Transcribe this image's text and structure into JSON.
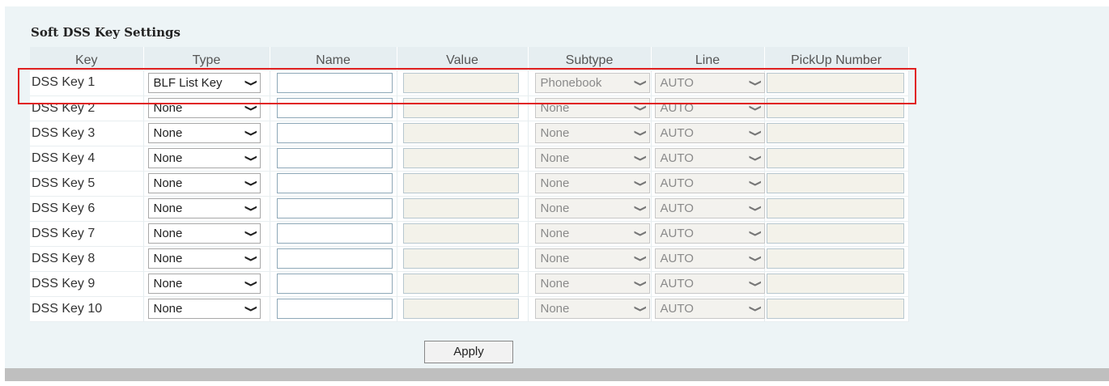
{
  "section_title": "Soft DSS Key Settings",
  "columns": [
    "Key",
    "Type",
    "Name",
    "Value",
    "Subtype",
    "Line",
    "PickUp Number"
  ],
  "rows": [
    {
      "key": "DSS Key 1",
      "type": "BLF List Key",
      "subtype": "Phonebook",
      "line": "AUTO"
    },
    {
      "key": "DSS Key 2",
      "type": "None",
      "subtype": "None",
      "line": "AUTO"
    },
    {
      "key": "DSS Key 3",
      "type": "None",
      "subtype": "None",
      "line": "AUTO"
    },
    {
      "key": "DSS Key 4",
      "type": "None",
      "subtype": "None",
      "line": "AUTO"
    },
    {
      "key": "DSS Key 5",
      "type": "None",
      "subtype": "None",
      "line": "AUTO"
    },
    {
      "key": "DSS Key 6",
      "type": "None",
      "subtype": "None",
      "line": "AUTO"
    },
    {
      "key": "DSS Key 7",
      "type": "None",
      "subtype": "None",
      "line": "AUTO"
    },
    {
      "key": "DSS Key 8",
      "type": "None",
      "subtype": "None",
      "line": "AUTO"
    },
    {
      "key": "DSS Key 9",
      "type": "None",
      "subtype": "None",
      "line": "AUTO"
    },
    {
      "key": "DSS Key 10",
      "type": "None",
      "subtype": "None",
      "line": "AUTO"
    }
  ],
  "apply_label": "Apply",
  "icons": {
    "dropdown": "chevron-down-icon"
  },
  "colors": {
    "highlight": "#e02020",
    "panel": "#edf4f6",
    "disabled_field": "#f3f2ea"
  }
}
